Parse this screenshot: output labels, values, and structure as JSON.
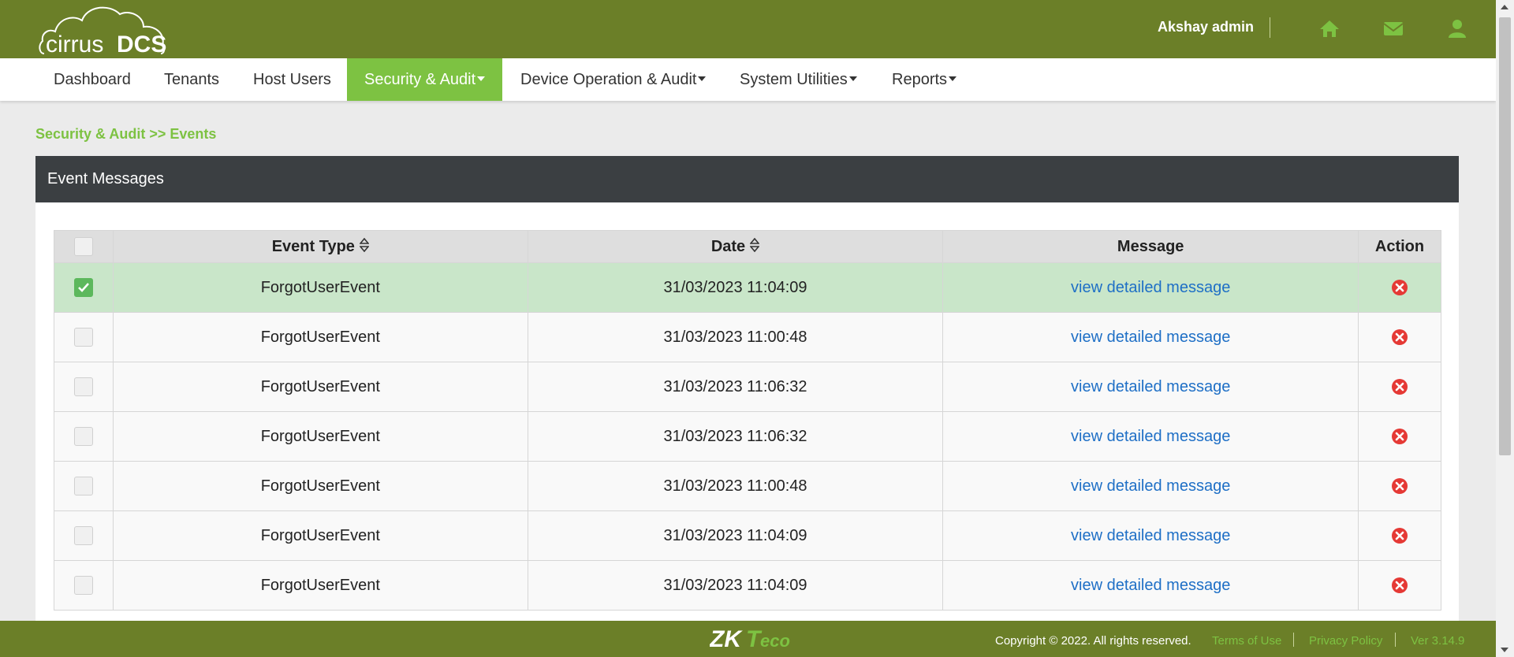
{
  "brand": {
    "logo_text_light": "cirrus",
    "logo_text_bold": "DCS",
    "accent": "#7dc242",
    "topbar_color": "#6b7f28"
  },
  "header": {
    "user_name": "Akshay admin",
    "icons": [
      "home-icon",
      "envelope-icon",
      "user-icon"
    ]
  },
  "nav": {
    "items": [
      {
        "label": "Dashboard",
        "dropdown": false
      },
      {
        "label": "Tenants",
        "dropdown": false
      },
      {
        "label": "Host Users",
        "dropdown": false
      },
      {
        "label": "Security & Audit",
        "dropdown": true,
        "active": true
      },
      {
        "label": "Device Operation & Audit",
        "dropdown": true
      },
      {
        "label": "System Utilities",
        "dropdown": true
      },
      {
        "label": "Reports",
        "dropdown": true
      }
    ]
  },
  "breadcrumb": "Security & Audit >> Events",
  "panel": {
    "title": "Event Messages"
  },
  "table": {
    "columns": [
      "Event Type",
      "Date",
      "Message",
      "Action"
    ],
    "rows": [
      {
        "checked": true,
        "event_type": "ForgotUserEvent",
        "date": "31/03/2023 11:04:09",
        "message": "view detailed message"
      },
      {
        "checked": false,
        "event_type": "ForgotUserEvent",
        "date": "31/03/2023 11:00:48",
        "message": "view detailed message"
      },
      {
        "checked": false,
        "event_type": "ForgotUserEvent",
        "date": "31/03/2023 11:06:32",
        "message": "view detailed message"
      },
      {
        "checked": false,
        "event_type": "ForgotUserEvent",
        "date": "31/03/2023 11:06:32",
        "message": "view detailed message"
      },
      {
        "checked": false,
        "event_type": "ForgotUserEvent",
        "date": "31/03/2023 11:00:48",
        "message": "view detailed message"
      },
      {
        "checked": false,
        "event_type": "ForgotUserEvent",
        "date": "31/03/2023 11:04:09",
        "message": "view detailed message"
      },
      {
        "checked": false,
        "event_type": "ForgotUserEvent",
        "date": "31/03/2023 11:04:09",
        "message": "view detailed message"
      }
    ]
  },
  "footer": {
    "logo_text": "ZKTeco",
    "copyright": "Copyright © 2022. All rights reserved.",
    "terms": "Terms of Use",
    "privacy": "Privacy Policy",
    "version": "Ver 3.14.9"
  }
}
